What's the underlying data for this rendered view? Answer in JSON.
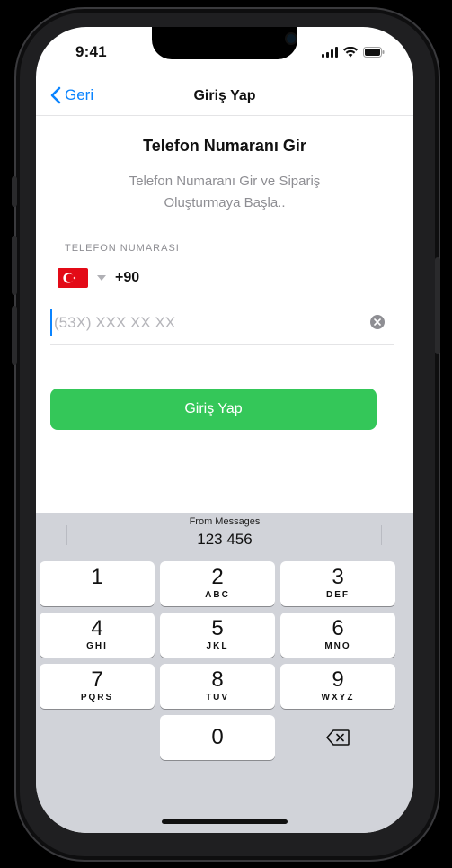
{
  "status_bar": {
    "time": "9:41"
  },
  "nav": {
    "back_label": "Geri",
    "title": "Giriş Yap"
  },
  "content": {
    "heading": "Telefon Numaranı Gir",
    "subtitle": "Telefon Numaranı Gir ve Sipariş Oluşturmaya Başla..",
    "phone_label": "TELEFON NUMARASI",
    "country_code": "+90",
    "phone_placeholder": "(53X) XXX XX XX",
    "phone_value": "",
    "submit_label": "Giriş Yap"
  },
  "keyboard": {
    "suggestion_source": "From Messages",
    "suggestion_code": "123 456",
    "keys": [
      {
        "num": "1",
        "letters": ""
      },
      {
        "num": "2",
        "letters": "ABC"
      },
      {
        "num": "3",
        "letters": "DEF"
      },
      {
        "num": "4",
        "letters": "GHI"
      },
      {
        "num": "5",
        "letters": "JKL"
      },
      {
        "num": "6",
        "letters": "MNO"
      },
      {
        "num": "7",
        "letters": "PQRS"
      },
      {
        "num": "8",
        "letters": "TUV"
      },
      {
        "num": "9",
        "letters": "WXYZ"
      },
      {
        "num": "0",
        "letters": ""
      }
    ]
  },
  "colors": {
    "accent": "#0a84ff",
    "primary_button": "#34c759",
    "flag_red": "#e30a17"
  }
}
